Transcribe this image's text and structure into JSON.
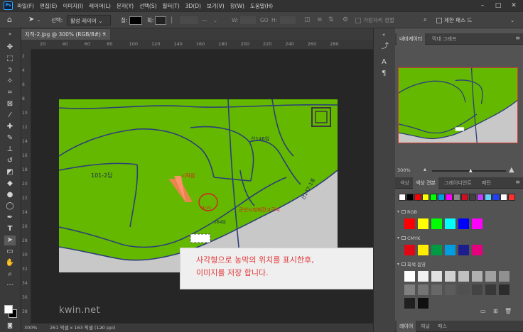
{
  "menubar": {
    "logo": "Ps",
    "items": [
      "파일(F)",
      "편집(E)",
      "이미지(I)",
      "레이어(L)",
      "문자(Y)",
      "선택(S)",
      "필터(T)",
      "3D(D)",
      "보기(V)",
      "창(W)",
      "도움말(H)"
    ]
  },
  "options": {
    "select_label": "선택:",
    "select_value": "활성 레이어",
    "fill_label": "칠:",
    "stroke_label": "획:",
    "w_label": "W:",
    "h_label": "H:",
    "go_label": "GO",
    "edge_align_label": "가장자리 정렬",
    "constrain_label": "제한 패스 드",
    "fill_color": "#000000"
  },
  "document": {
    "tab_title": "지적-2.jpg @ 300% (RGB/8#) *",
    "ruler_h_ticks": [
      "20",
      "40",
      "60",
      "80",
      "100",
      "120",
      "140",
      "160",
      "180",
      "200",
      "220",
      "240",
      "260",
      "280"
    ],
    "ruler_v_ticks": [
      "2",
      "4",
      "6",
      "8",
      "10",
      "12",
      "14",
      "16",
      "18",
      "20",
      "22",
      "24",
      "26",
      "28",
      "30",
      "32",
      "34",
      "36",
      "38"
    ]
  },
  "map_labels": {
    "lot1": "101-2답",
    "lot2": "산146임",
    "lot3": "산147-1종",
    "lot4": "164답",
    "red1": "시작점",
    "red2": "경사지",
    "red3": "군산시청재건고구석"
  },
  "status": {
    "zoom": "300%",
    "doc_info": "261 픽셀 x 163 픽셀 (120 ppi)"
  },
  "navigator": {
    "tab1": "내비게이터",
    "tab2": "막대 그래프",
    "zoom": "300%"
  },
  "swatches_panel": {
    "tabs": [
      "색상",
      "색상 견본",
      "그레이디언트",
      "패턴"
    ],
    "active_tab": 1,
    "recent": [
      "#ffffff",
      "#000000",
      "#ff0000",
      "#ffff00",
      "#00ff00",
      "#00a0e0",
      "#ff00ff",
      "#8a8a8a",
      "#d01020",
      "#404040",
      "#c040ff",
      "#60d0ff",
      "#2040ff",
      "#ffffff",
      "#ff3030"
    ],
    "groups": [
      {
        "name": "RGB",
        "colors": [
          "#ff0000",
          "#ffff00",
          "#00ff00",
          "#00ffff",
          "#0000ff",
          "#ff00ff"
        ]
      },
      {
        "name": "CMYK",
        "colors": [
          "#e30613",
          "#ffed00",
          "#009a44",
          "#009ee0",
          "#1d1d8f",
          "#e5007d"
        ]
      },
      {
        "name": "회색 음영",
        "colors": [
          "#ffffff",
          "#f0f0f0",
          "#e0e0e0",
          "#d0d0d0",
          "#c0c0c0",
          "#b0b0b0",
          "#a0a0a0",
          "#909090",
          "#808080",
          "#747474",
          "#686868",
          "#5c5c5c",
          "#505050",
          "#444444",
          "#383838",
          "#2c2c2c",
          "#202020",
          "#101010"
        ]
      }
    ]
  },
  "layers_panel": {
    "tabs": [
      "레이어",
      "채널",
      "패스"
    ]
  },
  "caption": {
    "line1": "사각형으로 농막의 위치를 표시한후,",
    "line2": "이미지를 저장 합니다."
  },
  "watermark": "kwin.net"
}
